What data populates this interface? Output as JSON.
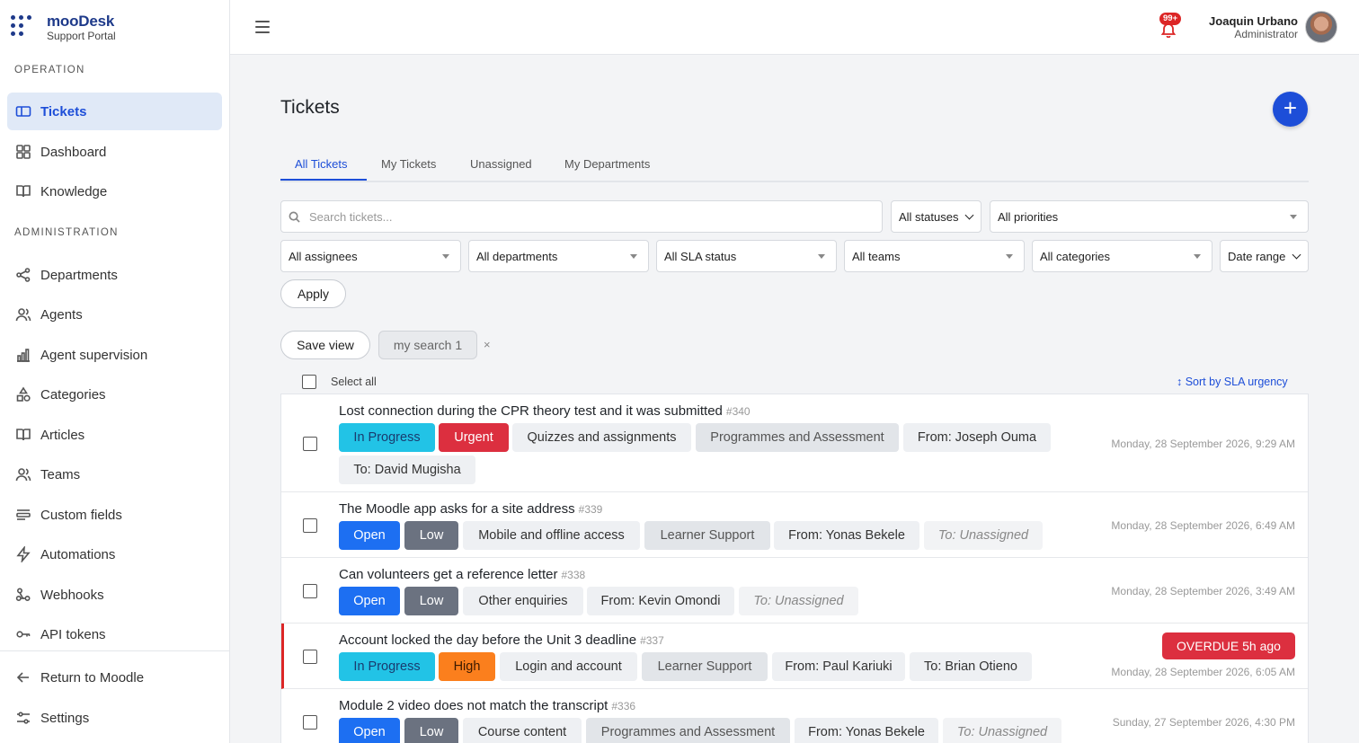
{
  "brand": {
    "name": "mooDesk",
    "subtitle": "Support Portal"
  },
  "sidebar": {
    "operation_title": "OPERATION",
    "administration_title": "ADMINISTRATION",
    "operation_items": [
      {
        "label": "Tickets",
        "icon": "ticket-icon",
        "active": true
      },
      {
        "label": "Dashboard",
        "icon": "grid-icon"
      },
      {
        "label": "Knowledge",
        "icon": "book-icon"
      }
    ],
    "admin_items": [
      {
        "label": "Departments",
        "icon": "share-icon"
      },
      {
        "label": "Agents",
        "icon": "users-icon"
      },
      {
        "label": "Agent supervision",
        "icon": "bar-chart-icon"
      },
      {
        "label": "Categories",
        "icon": "shapes-icon"
      },
      {
        "label": "Articles",
        "icon": "book-icon"
      },
      {
        "label": "Teams",
        "icon": "users-icon"
      },
      {
        "label": "Custom fields",
        "icon": "form-icon"
      },
      {
        "label": "Automations",
        "icon": "bolt-icon"
      },
      {
        "label": "Webhooks",
        "icon": "webhook-icon"
      },
      {
        "label": "API tokens",
        "icon": "key-icon"
      }
    ],
    "footer_items": [
      {
        "label": "Return to Moodle",
        "icon": "arrow-left-icon"
      },
      {
        "label": "Settings",
        "icon": "sliders-icon"
      }
    ]
  },
  "header": {
    "notification_count": "99+",
    "user_name": "Joaquin Urbano",
    "user_role": "Administrator"
  },
  "main": {
    "title": "Tickets",
    "tabs": [
      {
        "label": "All Tickets",
        "active": true
      },
      {
        "label": "My Tickets"
      },
      {
        "label": "Unassigned"
      },
      {
        "label": "My Departments"
      }
    ],
    "filters": {
      "search_placeholder": "Search tickets...",
      "status": "All statuses",
      "priority": "All priorities",
      "assignee": "All assignees",
      "department": "All departments",
      "sla": "All SLA status",
      "team": "All teams",
      "category": "All categories",
      "date_range": "Date range",
      "apply_label": "Apply"
    },
    "save_view_label": "Save view",
    "saved_view": "my search 1",
    "saved_view_remove": "×",
    "select_all_label": "Select all",
    "sort_label": "↕ Sort by SLA urgency"
  },
  "tickets": [
    {
      "title": "Lost connection during the CPR theory test and it was submitted",
      "id": "#340",
      "status": "In Progress",
      "priority": "Urgent",
      "category": "Quizzes and assignments",
      "department": "Programmes and Assessment",
      "from": "From: Joseph Ouma",
      "to": "To: David Mugisha",
      "date": "Monday, 28 September 2026, 9:29 AM"
    },
    {
      "title": "The Moodle app asks for a site address",
      "id": "#339",
      "status": "Open",
      "priority": "Low",
      "category": "Mobile and offline access",
      "department": "Learner Support",
      "from": "From: Yonas Bekele",
      "to": "To: Unassigned",
      "date": "Monday, 28 September 2026, 6:49 AM"
    },
    {
      "title": "Can volunteers get a reference letter",
      "id": "#338",
      "status": "Open",
      "priority": "Low",
      "category": "Other enquiries",
      "from": "From: Kevin Omondi",
      "to": "To: Unassigned",
      "date": "Monday, 28 September 2026, 3:49 AM"
    },
    {
      "title": "Account locked the day before the Unit 3 deadline",
      "id": "#337",
      "status": "In Progress",
      "priority": "High",
      "category": "Login and account",
      "department": "Learner Support",
      "from": "From: Paul Kariuki",
      "to": "To: Brian Otieno",
      "overdue": "OVERDUE 5h ago",
      "date": "Monday, 28 September 2026, 6:05 AM"
    },
    {
      "title": "Module 2 video does not match the transcript",
      "id": "#336",
      "status": "Open",
      "priority": "Low",
      "category": "Course content",
      "department": "Programmes and Assessment",
      "from": "From: Yonas Bekele",
      "to": "To: Unassigned",
      "date": "Sunday, 27 September 2026, 4:30 PM"
    }
  ],
  "colors": {
    "accent": "#1d4ed8",
    "status_in_progress": "#22c3e6",
    "status_open": "#1d6ff2",
    "priority_urgent": "#dc2f3f",
    "priority_high": "#fb7f1d",
    "priority_low": "#6b7280"
  }
}
